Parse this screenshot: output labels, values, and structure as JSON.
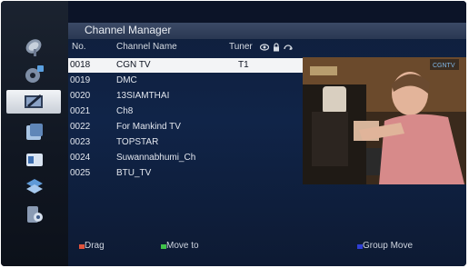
{
  "window": {
    "title": "Channel Manager"
  },
  "sidebar": {
    "items": [
      {
        "icon": "satellite-dish-icon"
      },
      {
        "icon": "settings-icon"
      },
      {
        "icon": "channel-edit-icon",
        "active": true
      },
      {
        "icon": "tools-icon"
      },
      {
        "icon": "media-icon"
      },
      {
        "icon": "network-icon"
      },
      {
        "icon": "system-info-icon"
      }
    ]
  },
  "table": {
    "headers": {
      "no": "No.",
      "name": "Channel Name",
      "tuner": "Tuner"
    },
    "header_icons": [
      "eye-icon",
      "lock-icon",
      "skip-icon"
    ],
    "rows": [
      {
        "no": "0018",
        "name": "CGN TV",
        "tuner": "T1",
        "selected": true
      },
      {
        "no": "0019",
        "name": "DMC",
        "tuner": ""
      },
      {
        "no": "0020",
        "name": "13SIAMTHAI",
        "tuner": ""
      },
      {
        "no": "0021",
        "name": "Ch8",
        "tuner": ""
      },
      {
        "no": "0022",
        "name": "For Mankind TV",
        "tuner": ""
      },
      {
        "no": "0023",
        "name": "TOPSTAR",
        "tuner": ""
      },
      {
        "no": "0024",
        "name": "Suwannabhumi_Ch",
        "tuner": ""
      },
      {
        "no": "0025",
        "name": "BTU_TV",
        "tuner": ""
      }
    ]
  },
  "preview": {
    "watermark": "CGNTV"
  },
  "footer": {
    "keys": [
      {
        "label": "Drag",
        "color": "#e0533c"
      },
      {
        "label": "Move to",
        "color": "#3fc24a"
      },
      {
        "label": "Group Move",
        "color": "#2f3fd6"
      }
    ]
  }
}
